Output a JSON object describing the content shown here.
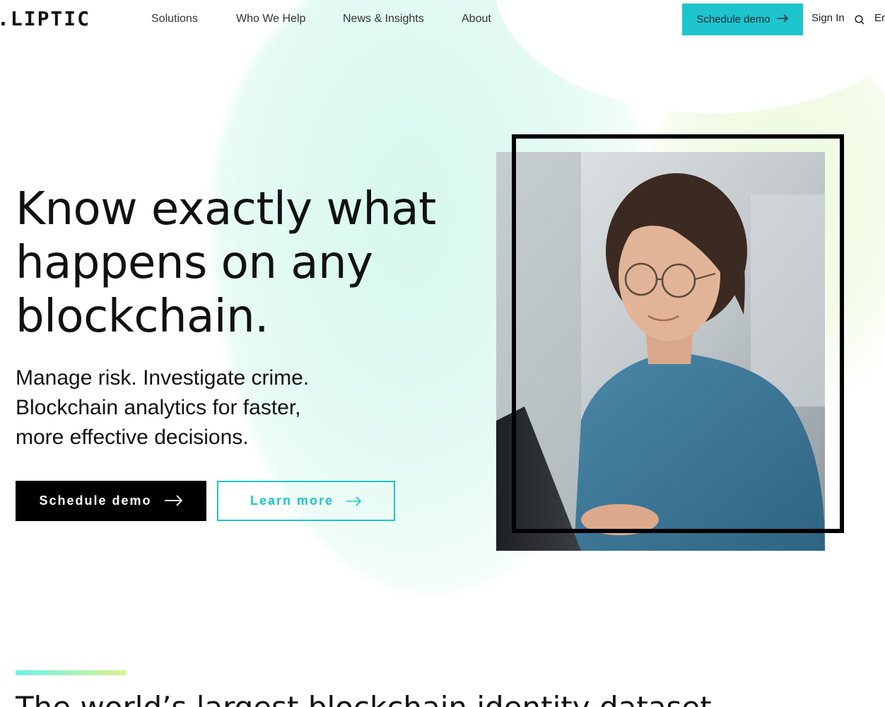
{
  "nav": {
    "logo": ".LIPTIC",
    "links": [
      "Solutions",
      "Who We Help",
      "News & Insights",
      "About"
    ],
    "cta": "Schedule demo",
    "signin": "Sign In",
    "lang": "En"
  },
  "hero": {
    "title_pre": "Know ",
    "title_highlight": "exactly",
    "title_post": " what happens on any blockchain.",
    "subtitle": "Manage risk. Investigate crime. Blockchain analytics for faster, more effective decisions.",
    "primary_button": "Schedule demo",
    "secondary_button": "Learn more"
  },
  "section": {
    "title": "The world’s largest blockchain identity dataset"
  },
  "colors": {
    "accent": "#1ec4cd",
    "highlight_start": "#6ff2ea",
    "highlight_end": "#d7f58c"
  },
  "icons": {
    "arrow": "arrow-right-icon",
    "search": "search-icon"
  }
}
